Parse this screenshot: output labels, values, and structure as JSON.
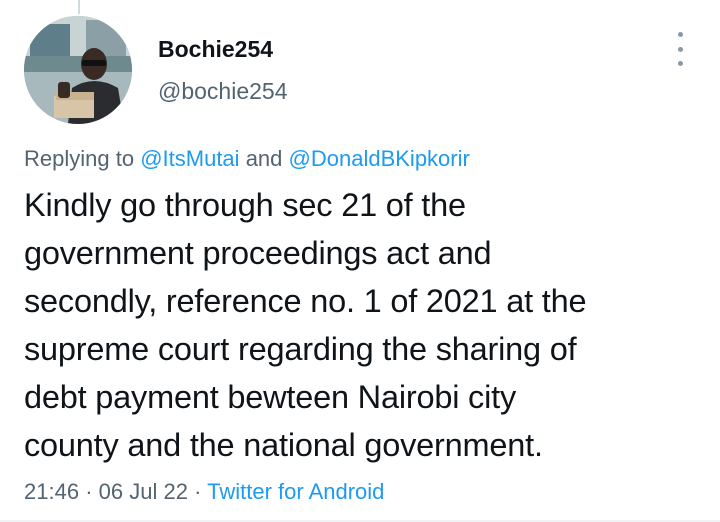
{
  "tweet": {
    "author": {
      "display_name": "Bochie254",
      "handle": "@bochie254"
    },
    "replying": {
      "prefix": "Replying to",
      "mentions": [
        "@ItsMutai",
        "@DonaldBKipkorir"
      ],
      "joiner": "and"
    },
    "text_lines": [
      "Kindly go through sec 21 of the",
      "government proceedings act and",
      "secondly, reference no. 1 of 2021 at the",
      "supreme court regarding the sharing of",
      "debt payment bewteen Nairobi city",
      "county and the national government."
    ],
    "time": "21:46",
    "date": "06 Jul 22",
    "separator": "·",
    "source": "Twitter for Android"
  },
  "icons": {
    "more": "more-vertical-icon",
    "avatar": "profile-photo"
  },
  "colors": {
    "link": "#1d9bf0",
    "secondary_text": "#536471",
    "primary_text": "#0f1419"
  }
}
